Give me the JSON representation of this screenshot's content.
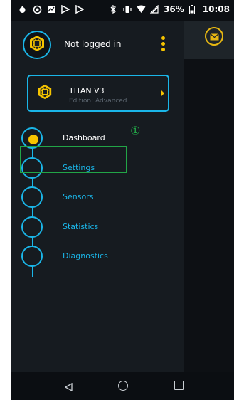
{
  "status_bar": {
    "battery": "36%",
    "time": "10:08"
  },
  "header": {
    "login_status": "Not logged in"
  },
  "device": {
    "name": "TITAN V3",
    "edition": "Edition: Advanced"
  },
  "nav": {
    "items": [
      {
        "label": "Dashboard",
        "active": true
      },
      {
        "label": "Settings",
        "active": false
      },
      {
        "label": "Sensors",
        "active": false
      },
      {
        "label": "Statistics",
        "active": false
      },
      {
        "label": "Diagnostics",
        "active": false
      }
    ]
  },
  "annotation": "①",
  "colors": {
    "accent_blue": "#1ab6e8",
    "accent_yellow": "#f6c400",
    "highlight_green": "#22a547",
    "drawer_bg": "#161b20"
  },
  "icons": {
    "avatar": "hex-chip-icon",
    "device": "hex-chip-icon",
    "mail": "mail-icon",
    "menu": "kebab-menu-icon"
  }
}
